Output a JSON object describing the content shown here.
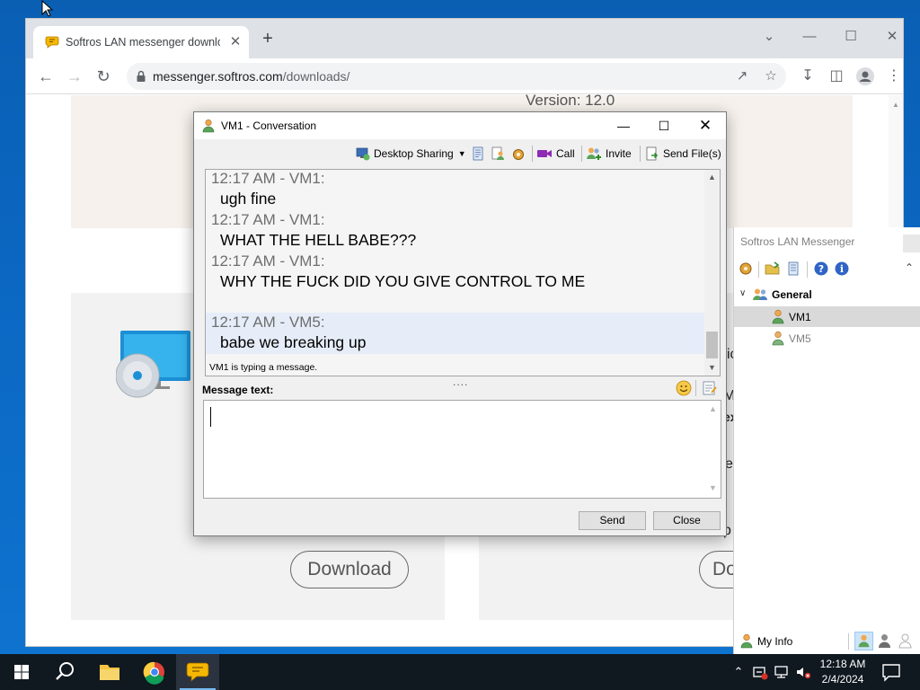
{
  "browser": {
    "tab_title": "Softros LAN messenger downlo",
    "tab_close": "✕",
    "new_tab": "+",
    "url_host": "messenger.softros.com",
    "url_path": "/downloads/",
    "window_controls": {
      "tab_search": "⌄",
      "minimize": "—",
      "maximize": "☐",
      "close": "✕"
    }
  },
  "page": {
    "version": "Version: 12.0",
    "download_left": "Download",
    "download_right": "Do",
    "partial_text_1": "ic",
    "partial_text_2": "M",
    "partial_text_3": "ex",
    "partial_text_4": "e",
    "partial_text_5": "p"
  },
  "conversation": {
    "title": "VM1 - Conversation",
    "toolbar": {
      "desktop_sharing": "Desktop Sharing",
      "call": "Call",
      "invite": "Invite",
      "send_files": "Send File(s)"
    },
    "messages": [
      {
        "header": "12:17 AM - VM1:",
        "text": "ugh fine",
        "highlight": false
      },
      {
        "header": "12:17 AM - VM1:",
        "text": "WHAT THE HELL BABE???",
        "highlight": false
      },
      {
        "header": "12:17 AM - VM1:",
        "text": "WHY THE FUCK DID YOU GIVE CONTROL TO ME",
        "highlight": false
      },
      {
        "header": "12:17 AM - VM5:",
        "text": "babe we breaking up",
        "highlight": true
      }
    ],
    "typing_status": "VM1 is typing a message.",
    "splitter": "....",
    "message_label": "Message text:",
    "message_value": "",
    "send": "Send",
    "close": "Close"
  },
  "messenger": {
    "title": "Softros LAN Messenger",
    "group": "General",
    "contacts": [
      {
        "name": "VM1",
        "selected": true,
        "online": true
      },
      {
        "name": "VM5",
        "selected": false,
        "online": false
      }
    ],
    "my_info": "My Info"
  },
  "taskbar": {
    "time": "12:18 AM",
    "date": "2/4/2024"
  },
  "colors": {
    "accent_blue": "#0b67c2",
    "selection_blue": "#e6edf9",
    "contact_selected": "#d9d9d9"
  }
}
